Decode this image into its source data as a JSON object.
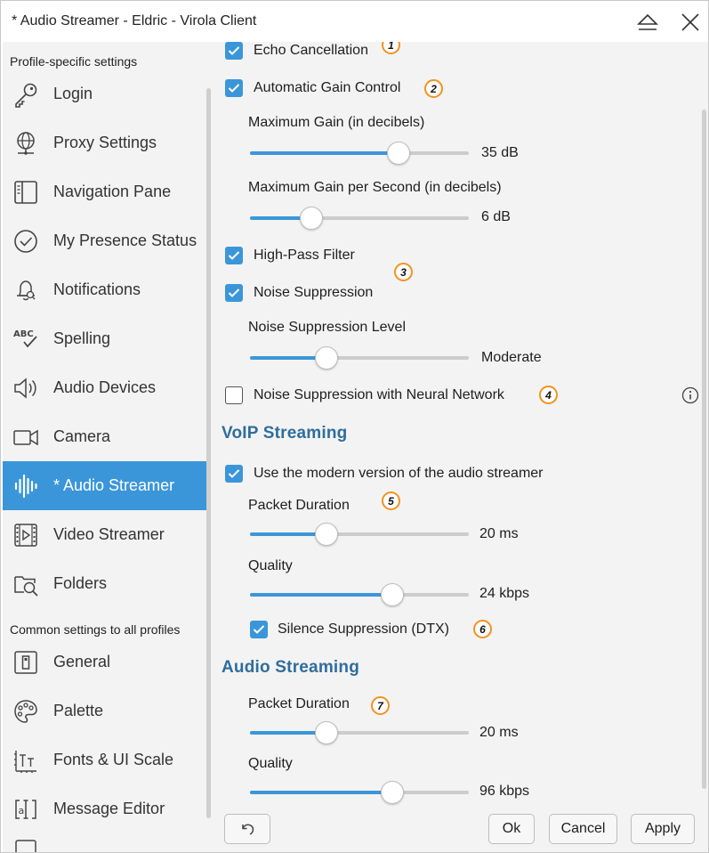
{
  "window": {
    "title": "* Audio Streamer - Eldric - Virola Client"
  },
  "titlebar": {
    "eject_icon": "eject-icon",
    "close_icon": "close-icon"
  },
  "sidebar": {
    "profile_section_label": "Profile-specific settings",
    "common_section_label": "Common settings to all profiles",
    "profile_items": [
      {
        "label": "Login",
        "icon": "key-icon"
      },
      {
        "label": "Proxy Settings",
        "icon": "globe-icon"
      },
      {
        "label": "Navigation Pane",
        "icon": "panel-icon"
      },
      {
        "label": "My Presence Status",
        "icon": "check-circle-icon"
      },
      {
        "label": "Notifications",
        "icon": "bell-icon"
      },
      {
        "label": "Spelling",
        "icon": "spelling-icon"
      },
      {
        "label": "Audio Devices",
        "icon": "speaker-icon"
      },
      {
        "label": "Camera",
        "icon": "camera-icon"
      },
      {
        "label": "* Audio Streamer",
        "icon": "audio-wave-icon",
        "active": true
      },
      {
        "label": "Video Streamer",
        "icon": "film-icon"
      },
      {
        "label": "Folders",
        "icon": "folder-search-icon"
      }
    ],
    "common_items": [
      {
        "label": "General",
        "icon": "general-icon"
      },
      {
        "label": "Palette",
        "icon": "palette-icon"
      },
      {
        "label": "Fonts & UI Scale",
        "icon": "font-scale-icon"
      },
      {
        "label": "Message Editor",
        "icon": "text-cursor-icon"
      }
    ],
    "spelling_icon_text": "ABC",
    "accent_color": "#3b96d9"
  },
  "main": {
    "echo_cancellation": {
      "label": "Echo Cancellation",
      "checked": true,
      "badge": "1"
    },
    "agc": {
      "label": "Automatic Gain Control",
      "checked": true,
      "badge": "2"
    },
    "max_gain": {
      "label": "Maximum Gain (in decibels)",
      "value": "35 dB",
      "level": 0.68
    },
    "max_gain_per_sec": {
      "label": "Maximum Gain per Second (in decibels)",
      "value": "6 dB",
      "level": 0.28
    },
    "high_pass": {
      "label": "High-Pass Filter",
      "checked": true,
      "badge": "3"
    },
    "noise_suppression": {
      "label": "Noise Suppression",
      "checked": true
    },
    "ns_level": {
      "label": "Noise Suppression Level",
      "value": "Moderate",
      "level": 0.35
    },
    "ns_neural": {
      "label": "Noise Suppression with Neural Network",
      "checked": false,
      "badge": "4",
      "info_icon": "info-icon"
    },
    "voip_heading": "VoIP Streaming",
    "modern_streamer": {
      "label": "Use the modern version of the audio streamer",
      "checked": true
    },
    "voip_packet": {
      "label": "Packet Duration",
      "value": "20 ms",
      "level": 0.35,
      "badge": "5"
    },
    "voip_quality": {
      "label": "Quality",
      "value": "24 kbps",
      "level": 0.65
    },
    "dtx": {
      "label": "Silence Suppression (DTX)",
      "checked": true,
      "badge": "6"
    },
    "audio_heading": "Audio Streaming",
    "audio_packet": {
      "label": "Packet Duration",
      "value": "20 ms",
      "level": 0.35,
      "badge": "7"
    },
    "audio_quality": {
      "label": "Quality",
      "value": "96 kbps",
      "level": 0.65
    }
  },
  "footer": {
    "reset_icon": "undo-icon",
    "ok_label": "Ok",
    "cancel_label": "Cancel",
    "apply_label": "Apply"
  },
  "colors": {
    "accent": "#3b96d9",
    "heading": "#2f6d9c",
    "badge_ring": "#f2921f"
  }
}
